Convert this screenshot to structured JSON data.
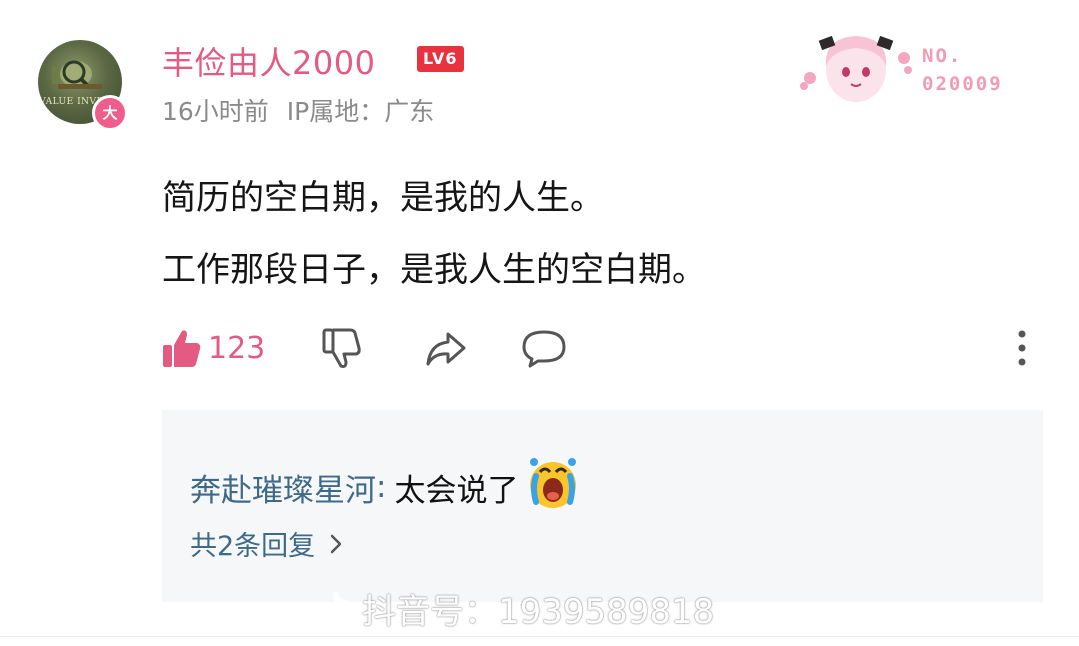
{
  "comment": {
    "avatar_text": "VALUE INVESTI",
    "avatar_badge": "大",
    "username": "丰俭由人2000",
    "level": "LV6",
    "time": "16小时前",
    "ip_label": "IP属地：广东",
    "deco_no_label": "NO.",
    "deco_no_value": "020009",
    "lines": [
      "简历的空白期，是我的人生。",
      "工作那段日子，是我人生的空白期。"
    ],
    "like_count": "123",
    "icons": {
      "like": "thumbs-up-icon",
      "dislike": "thumbs-down-icon",
      "share": "share-icon",
      "reply": "comment-icon",
      "more": "more-vertical-icon"
    }
  },
  "reply": {
    "author": "奔赴璀璨星河",
    "separator": ":",
    "text": "太会说了",
    "emoji": "crying-face-emoji",
    "count_label": "共2条回复",
    "chevron": "chevron-right-icon"
  },
  "watermark": {
    "text": "抖音号：1939589818"
  },
  "colors": {
    "username": "#e35a82",
    "level_badge": "#e8333f",
    "reply_author": "#3f6a87",
    "meta": "#8a8a8a",
    "reply_bg": "#f6f7f8"
  }
}
